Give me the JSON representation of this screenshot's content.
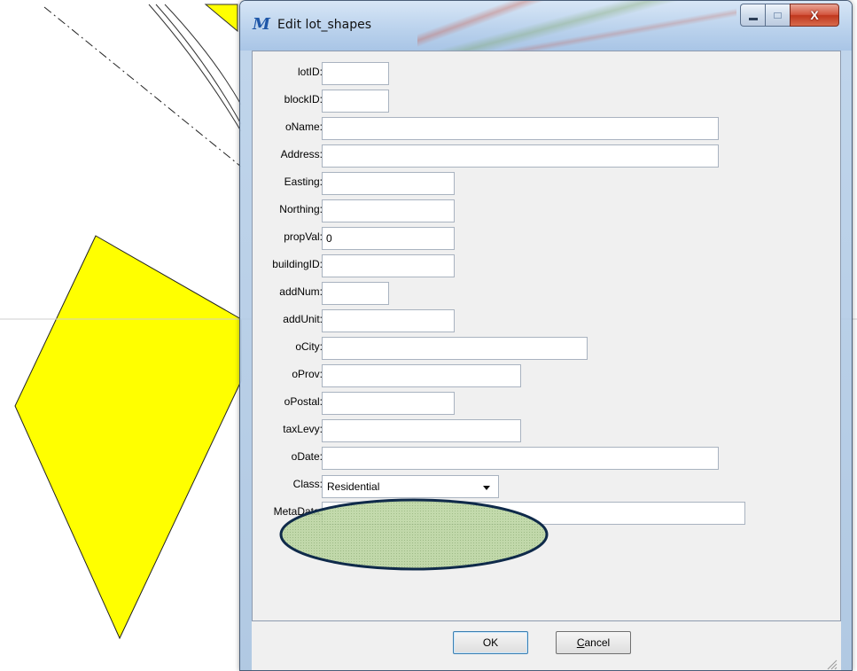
{
  "window": {
    "title": "Edit lot_shapes",
    "minimize_label": "▁",
    "maximize_label": "▫",
    "close_label": "X"
  },
  "form": {
    "fields": [
      {
        "label": "lotID:",
        "value": ""
      },
      {
        "label": "blockID:",
        "value": ""
      },
      {
        "label": "oName:",
        "value": ""
      },
      {
        "label": "Address:",
        "value": ""
      },
      {
        "label": "Easting:",
        "value": ""
      },
      {
        "label": "Northing:",
        "value": ""
      },
      {
        "label": "propVal:",
        "value": "0"
      },
      {
        "label": "buildingID:",
        "value": ""
      },
      {
        "label": "addNum:",
        "value": ""
      },
      {
        "label": "addUnit:",
        "value": ""
      },
      {
        "label": "oCity:",
        "value": ""
      },
      {
        "label": "oProv:",
        "value": ""
      },
      {
        "label": "oPostal:",
        "value": ""
      },
      {
        "label": "taxLevy:",
        "value": ""
      },
      {
        "label": "oDate:",
        "value": ""
      },
      {
        "label": "Class:",
        "value": "Residential"
      },
      {
        "label": "MetaData:",
        "value": ""
      }
    ]
  },
  "buttons": {
    "ok": "OK",
    "cancel": "Cancel"
  },
  "colors": {
    "lot_fill": "#ffff00",
    "highlight_fill": "#a8c98a",
    "highlight_stroke": "#0f2a4a"
  }
}
